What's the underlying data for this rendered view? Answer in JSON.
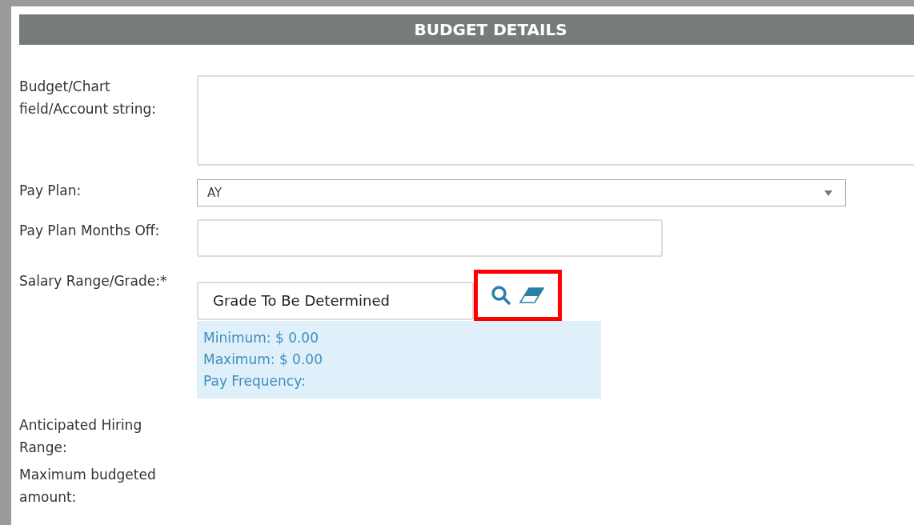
{
  "section_title": "BUDGET DETAILS",
  "fields": [
    {
      "kind": "textarea",
      "label": "Budget/Chart field/Account string:"
    },
    {
      "kind": "select",
      "label": "Pay Plan:",
      "value": "AY"
    },
    {
      "kind": "text",
      "label": "Pay Plan Months Off:"
    },
    {
      "kind": "lookup",
      "label": "Salary Range/Grade:*",
      "value": "Grade To Be Determined",
      "highlighted": true,
      "info": [
        "Minimum: $ 0.00",
        "Maximum: $ 0.00",
        "Pay Frequency:"
      ]
    },
    {
      "kind": "plain",
      "label": "Anticipated Hiring Range:"
    },
    {
      "kind": "plain",
      "label": "Maximum budgeted amount:"
    }
  ]
}
